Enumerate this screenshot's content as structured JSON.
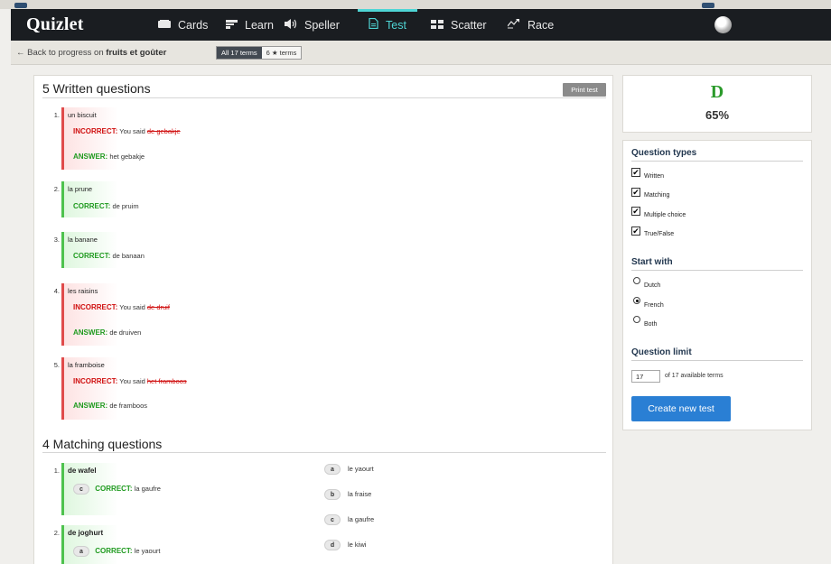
{
  "nav": {
    "logo": "Quizlet",
    "items": [
      {
        "label": "Cards",
        "icon": "cards-icon"
      },
      {
        "label": "Learn",
        "icon": "learn-icon"
      },
      {
        "label": "Speller",
        "icon": "speaker-icon"
      },
      {
        "label": "Test",
        "icon": "document-icon",
        "active": true
      },
      {
        "label": "Scatter",
        "icon": "scatter-icon"
      },
      {
        "label": "Race",
        "icon": "race-icon"
      }
    ]
  },
  "subbar": {
    "back_prefix": "← Back to progress on",
    "set_name": "fruits et goûter",
    "filter_all": "All 17 terms",
    "filter_starred": "6 ★ terms"
  },
  "written": {
    "title": "5 Written questions",
    "print_label": "Print test",
    "questions": [
      {
        "num": "1.",
        "prompt": "un biscuit",
        "status": "INCORRECT:",
        "said_prefix": "You said",
        "said": "de gebakje",
        "answer_label": "ANSWER:",
        "answer": "het gebakje"
      },
      {
        "num": "2.",
        "prompt": "la prune",
        "status": "CORRECT:",
        "answer": "de pruim"
      },
      {
        "num": "3.",
        "prompt": "la banane",
        "status": "CORRECT:",
        "answer": "de banaan"
      },
      {
        "num": "4.",
        "prompt": "les raisins",
        "status": "INCORRECT:",
        "said_prefix": "You said",
        "said": "de druif",
        "answer_label": "ANSWER:",
        "answer": "de druiven"
      },
      {
        "num": "5.",
        "prompt": "la framboise",
        "status": "INCORRECT:",
        "said_prefix": "You said",
        "said": "het framboos",
        "answer_label": "ANSWER:",
        "answer": "de framboos"
      }
    ]
  },
  "matching": {
    "title": "4 Matching questions",
    "questions": [
      {
        "num": "1.",
        "prompt": "de wafel",
        "choice": "c",
        "status": "CORRECT:",
        "answer": "la gaufre"
      },
      {
        "num": "2.",
        "prompt": "de joghurt",
        "choice": "a",
        "status": "CORRECT:",
        "answer": "le yaourt"
      }
    ],
    "options": [
      {
        "letter": "a",
        "text": "le yaourt"
      },
      {
        "letter": "b",
        "text": "la fraise"
      },
      {
        "letter": "c",
        "text": "la gaufre"
      },
      {
        "letter": "d",
        "text": "le kiwi"
      }
    ]
  },
  "grade": {
    "letter": "D",
    "percent": "65%",
    "color": "#2b9a2b"
  },
  "options": {
    "types_heading": "Question types",
    "types": [
      {
        "label": "Written",
        "checked": true
      },
      {
        "label": "Matching",
        "checked": true
      },
      {
        "label": "Multiple choice",
        "checked": true
      },
      {
        "label": "True/False",
        "checked": true
      }
    ],
    "start_heading": "Start with",
    "start": [
      {
        "label": "Dutch",
        "selected": false
      },
      {
        "label": "French",
        "selected": true
      },
      {
        "label": "Both",
        "selected": false
      }
    ],
    "limit_heading": "Question limit",
    "limit_value": "17",
    "limit_suffix": "of 17 available terms",
    "create_label": "Create new test"
  },
  "colors": {
    "accent": "#4fd5d5",
    "incorrect": "#d01010",
    "correct": "#1e9a1e",
    "button": "#2a7fd4"
  }
}
